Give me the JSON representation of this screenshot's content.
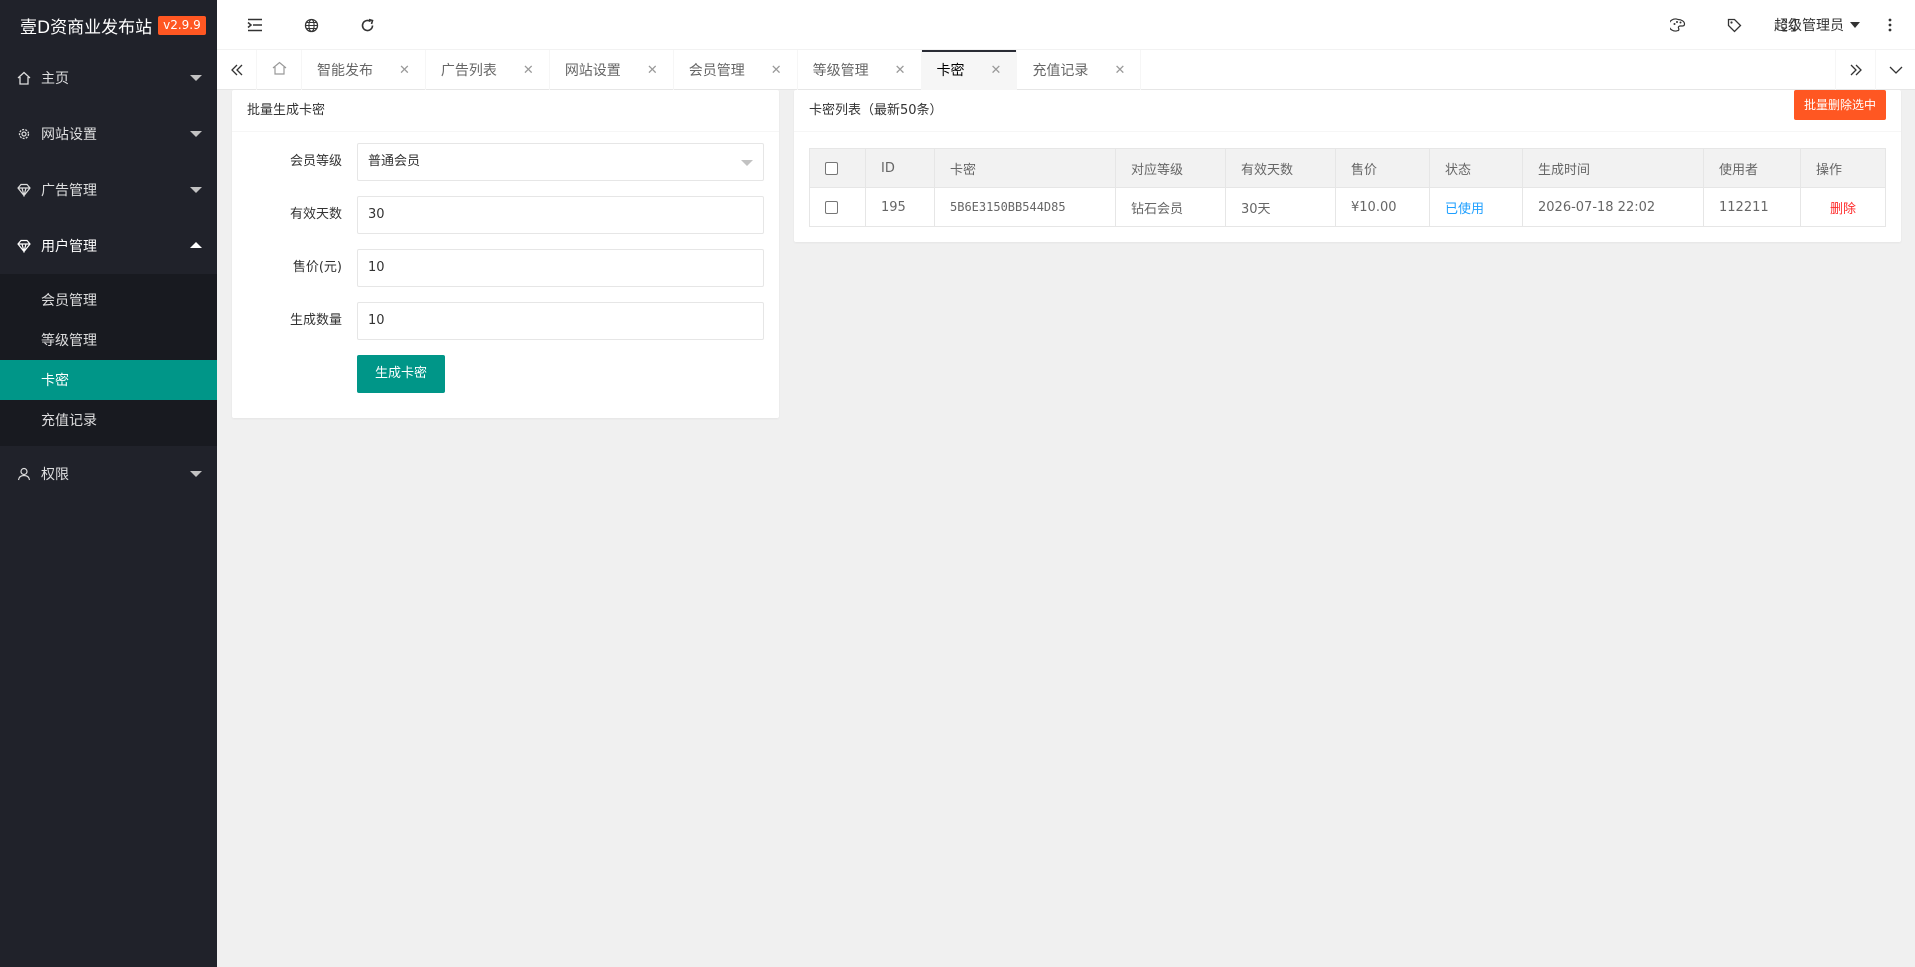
{
  "app": {
    "title": "壹D资商业发布站",
    "version": "v2.9.9"
  },
  "sidebar": {
    "items": [
      {
        "label": "主页",
        "icon": "home-icon"
      },
      {
        "label": "网站设置",
        "icon": "gear-icon"
      },
      {
        "label": "广告管理",
        "icon": "diamond-icon"
      },
      {
        "label": "用户管理",
        "icon": "diamond-icon"
      },
      {
        "label": "权限",
        "icon": "user-icon"
      }
    ],
    "subitems": [
      {
        "label": "会员管理"
      },
      {
        "label": "等级管理"
      },
      {
        "label": "卡密"
      },
      {
        "label": "充值记录"
      }
    ]
  },
  "header": {
    "user_label": "超级管理员"
  },
  "tabs": [
    {
      "label": "智能发布"
    },
    {
      "label": "广告列表"
    },
    {
      "label": "网站设置"
    },
    {
      "label": "会员管理"
    },
    {
      "label": "等级管理"
    },
    {
      "label": "卡密"
    },
    {
      "label": "充值记录"
    }
  ],
  "form": {
    "title": "批量生成卡密",
    "level_label": "会员等级",
    "level_value": "普通会员",
    "days_label": "有效天数",
    "days_value": "30",
    "price_label": "售价(元)",
    "price_value": "10",
    "count_label": "生成数量",
    "count_value": "10",
    "submit_label": "生成卡密"
  },
  "list": {
    "title": "卡密列表（最新50条）",
    "batch_delete_label": "批量删除选中",
    "columns": [
      "ID",
      "卡密",
      "对应等级",
      "有效天数",
      "售价",
      "状态",
      "生成时间",
      "使用者",
      "操作"
    ],
    "rows": [
      {
        "id": "195",
        "code": "5B6E3150BB544D85",
        "level": "钻石会员",
        "days": "30天",
        "price": "¥10.00",
        "status": "已使用",
        "created": "2026-07-18 22:02",
        "user": "112211",
        "action": "删除"
      }
    ]
  },
  "colors": {
    "accent": "#009688",
    "danger": "#ff5722",
    "sidebar_bg": "#20222a",
    "link": "#1e9fff"
  }
}
